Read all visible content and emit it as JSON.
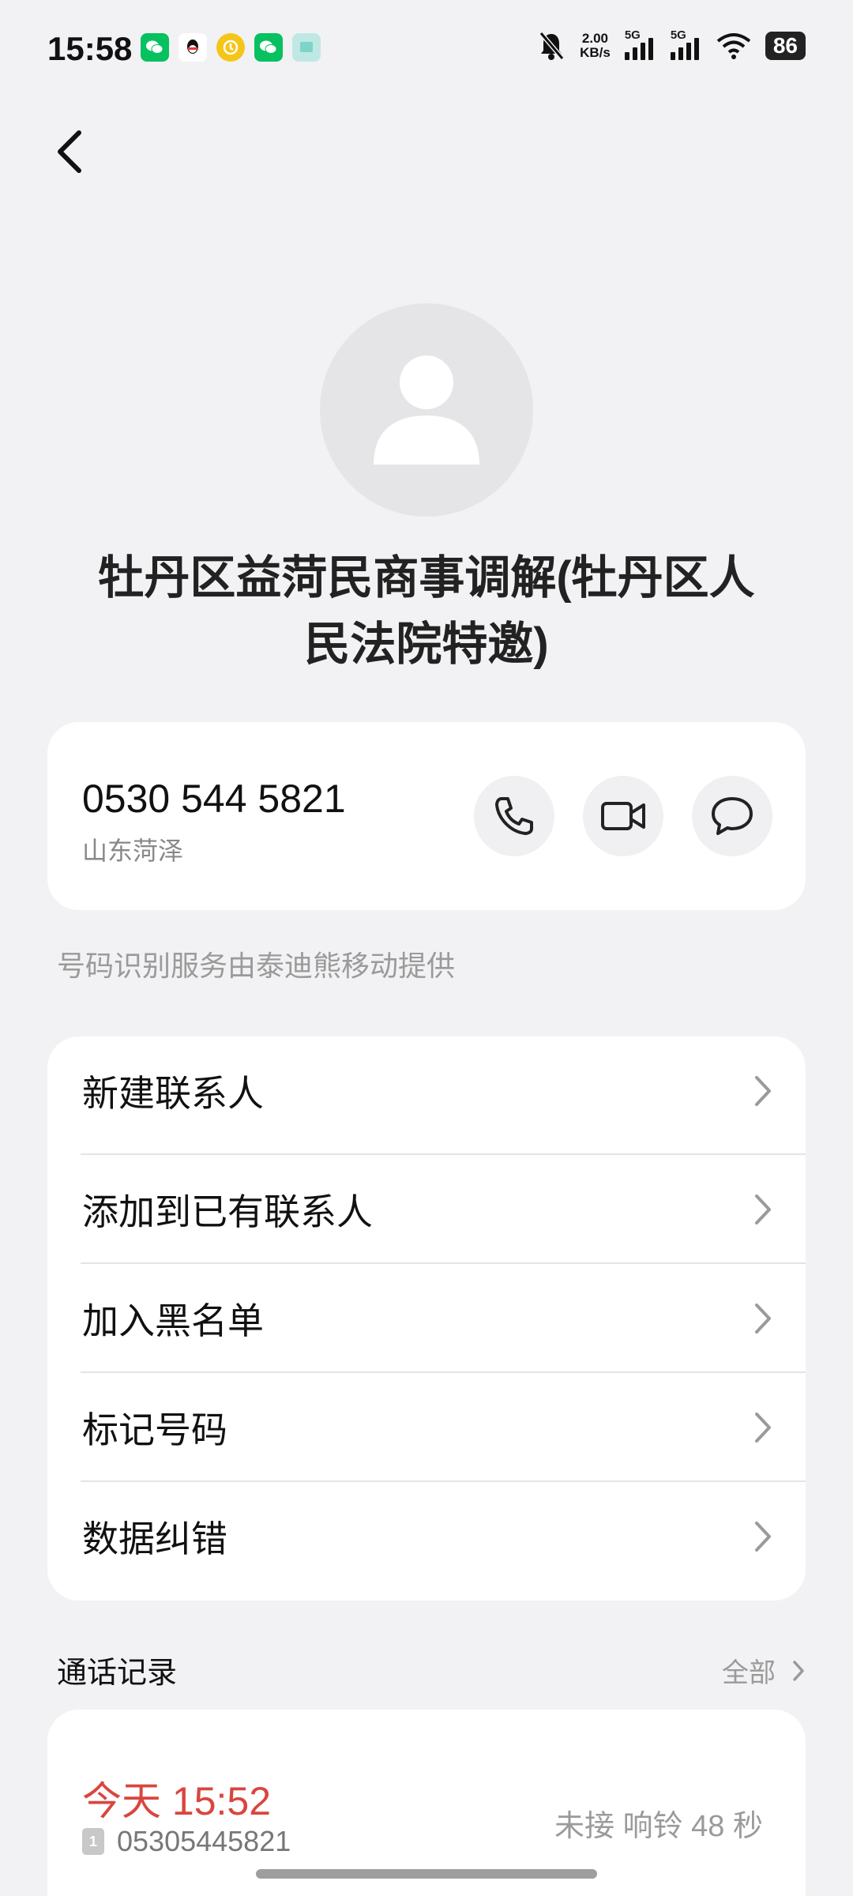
{
  "status_bar": {
    "time": "15:58",
    "net_speed_value": "2.00",
    "net_speed_unit": "KB/s",
    "sim1_label": "5G",
    "sim2_label": "5G",
    "battery": "86"
  },
  "contact": {
    "name": "牡丹区益菏民商事调解(牡丹区人民法院特邀)",
    "phone": "0530 544 5821",
    "location": "山东菏泽"
  },
  "provider_note": "号码识别服务由泰迪熊移动提供",
  "menu": [
    {
      "label": "新建联系人"
    },
    {
      "label": "添加到已有联系人"
    },
    {
      "label": "加入黑名单"
    },
    {
      "label": "标记号码"
    },
    {
      "label": "数据纠错"
    }
  ],
  "call_log": {
    "title": "通话记录",
    "all_label": "全部",
    "entries": [
      {
        "time": "今天 15:52",
        "sim": "1",
        "number": "05305445821",
        "status": "未接 响铃 48 秒"
      }
    ]
  },
  "colors": {
    "background": "#f2f2f4",
    "card": "#ffffff",
    "missed_call": "#d9463f",
    "secondary_text": "#9a9a9a"
  },
  "icons": [
    "back-arrow-icon",
    "person-icon",
    "phone-icon",
    "video-call-icon",
    "message-icon",
    "chevron-right-icon"
  ]
}
